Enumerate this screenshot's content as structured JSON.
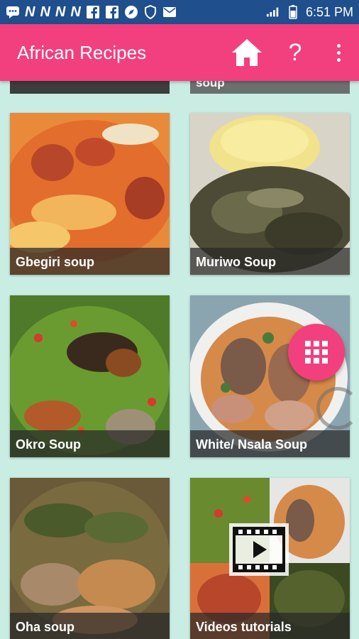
{
  "status_bar": {
    "time": "6:51 PM",
    "icons": [
      "message-icon",
      "n-icon",
      "n-icon",
      "n-icon",
      "n-icon",
      "facebook-icon",
      "facebook-icon",
      "compass-icon",
      "shield-icon",
      "mail-icon",
      "signal-icon",
      "battery-icon"
    ],
    "n_letter": "N"
  },
  "app_bar": {
    "title": "African Recipes",
    "help_label": "?",
    "icons": [
      "home-icon",
      "help-icon",
      "more-vert-icon"
    ]
  },
  "grid": {
    "top_partial_right": "soup",
    "tiles": [
      {
        "label": "Gbegiri soup"
      },
      {
        "label": "Muriwo Soup"
      },
      {
        "label": "Okro Soup"
      },
      {
        "label": "White/ Nsala Soup"
      },
      {
        "label": "Oha soup"
      },
      {
        "label": "Videos tutorials"
      }
    ]
  },
  "colors": {
    "status_bar": "#1f4f8c",
    "app_bar": "#f23f7e",
    "background": "#c9ece3",
    "fab": "#f23f7e"
  },
  "fab": {
    "icon": "grid-apps-icon"
  },
  "video_overlay": {
    "icon": "video-play-icon"
  }
}
